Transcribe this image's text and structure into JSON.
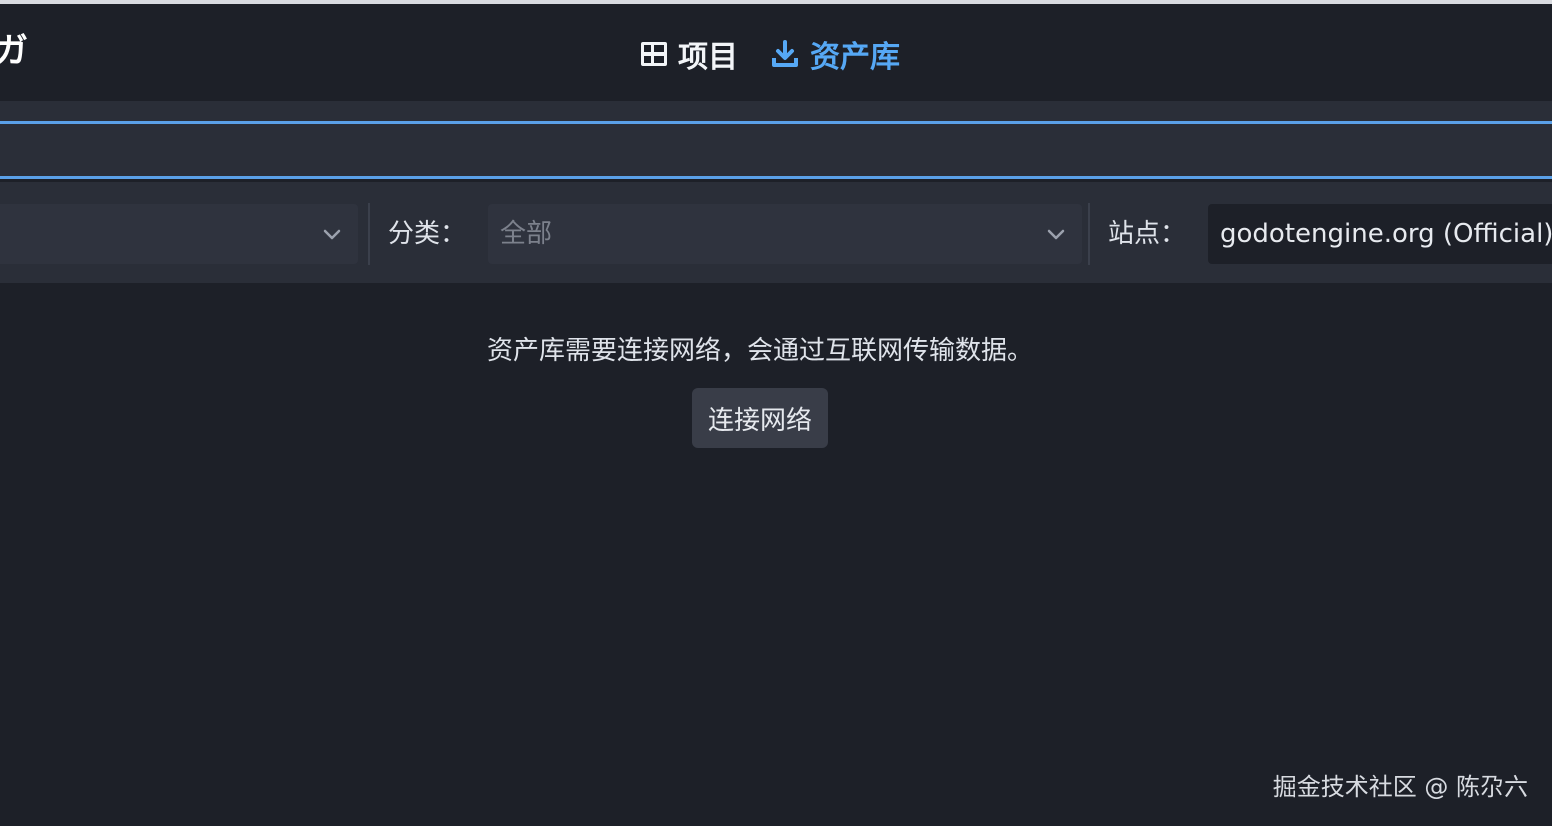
{
  "window": {
    "cut_title": "ガ"
  },
  "tabs": [
    {
      "label": "项目",
      "icon": "project-list-icon",
      "active": false
    },
    {
      "label": "资产库",
      "icon": "download-icon",
      "active": true,
      "color": "#56a8f5"
    }
  ],
  "filters": {
    "category_label": "分类：",
    "category_value": "全部",
    "site_label": "站点：",
    "site_value": "godotengine.org (Official)"
  },
  "main": {
    "message": "资产库需要连接网络，会通过互联网传输数据。",
    "connect_label": "连接网络"
  },
  "watermark": "掘金技术社区 @ 陈尕六",
  "colors": {
    "accent": "#56a8f5",
    "background": "#1d2028",
    "panel": "#2a2e38"
  }
}
